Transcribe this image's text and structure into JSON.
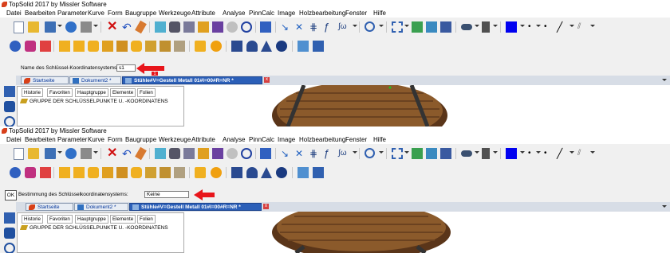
{
  "app": {
    "title": "TopSolid 2017 by Missler Software"
  },
  "menu": [
    "Datei",
    "Bearbeiten",
    "Parameter",
    "Kurve",
    "Form",
    "Baugruppe",
    "Werkzeuge",
    "Attribute",
    "Analyse",
    "PinnCalc",
    "Image",
    "Holzbearbeitung",
    "Fenster",
    "Hilfe"
  ],
  "panel1": {
    "field_label": "Name des Schlüssel-Koordinatensystems:",
    "field_value": "s1",
    "marker": "1",
    "tabs": [
      "Startseite",
      "Dokument2 *",
      "Stühle#V=Gestell Metall 01#I=00#R=NR *"
    ],
    "tab_close": "x",
    "tree_tabs": [
      "Historie",
      "Favoriten",
      "Hauptgruppe",
      "Elemente",
      "Folien"
    ],
    "tree_item": "GRUPPE DER SCHLÜSSELPUNKTE U. -KOORDINATENS"
  },
  "panel2": {
    "ok_label": "OK",
    "field_label": "Bestimmung des Schlüsselkoordinatensystems:",
    "field_value": "Keine",
    "tabs": [
      "Startseite",
      "Dokument2 *",
      "Stühle#V=Gestell Metall 01#I=00#R=NR *"
    ],
    "tab_close": "x",
    "tree_tabs": [
      "Historie",
      "Favoriten",
      "Hauptgruppe",
      "Elemente",
      "Folien"
    ],
    "tree_item": "GRUPPE DER SCHLÜSSELPUNKTE U. -KOORDINATENS"
  },
  "colors": {
    "arrow": "#e8151b",
    "active_tab": "#2b5fb8",
    "wood": "#8b5a2b"
  },
  "icons": {
    "toolbar1": [
      "new-doc-icon",
      "open-folder-icon",
      "save-icon",
      "info-icon",
      "print-icon",
      "delete-icon",
      "undo-icon",
      "eraser-icon",
      "filter-icon",
      "car-icon",
      "sliders-icon",
      "pencil-ruler-icon",
      "cubes-icon",
      "magnet-icon",
      "measure-icon",
      "key-point-icon",
      "cut-icon",
      "dimension-icon",
      "bend-icon",
      "signature-icon",
      "zoom-icon",
      "zoom-window-icon",
      "view-icon",
      "view2-icon",
      "view3-icon",
      "glasses-icon",
      "layers-icon",
      "color-icon",
      "dot-icon",
      "dot2-icon",
      "line-icon",
      "hatch-icon"
    ],
    "toolbar2": [
      "sphere-icon",
      "cube-icon",
      "cylinder-icon",
      "box-icon",
      "part-icon",
      "part2-icon",
      "part3-icon",
      "part4-icon",
      "part5-icon",
      "part6-icon",
      "part7-icon",
      "part8-icon",
      "part9-icon",
      "part10-icon",
      "part11-icon",
      "cone-icon",
      "torus-icon",
      "grid-icon",
      "grid2-icon"
    ]
  }
}
